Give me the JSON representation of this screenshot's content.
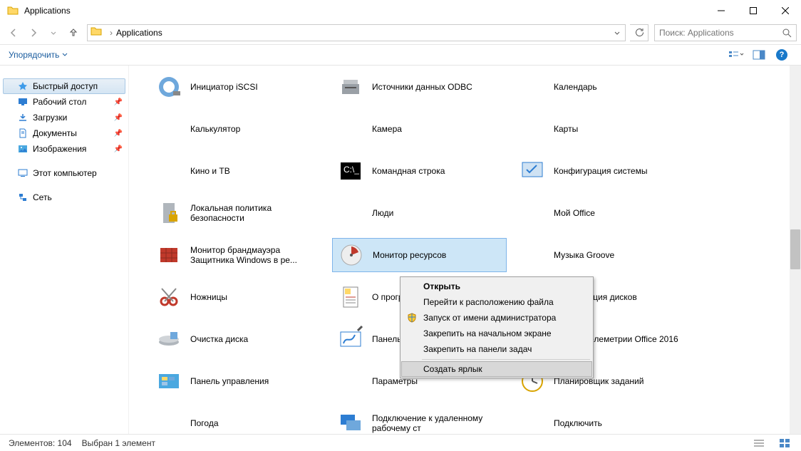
{
  "window": {
    "title": "Applications"
  },
  "address": {
    "breadcrumb": "Applications"
  },
  "search": {
    "placeholder": "Поиск: Applications"
  },
  "toolbar": {
    "organize_label": "Упорядочить"
  },
  "sidebar": {
    "quick_access": "Быстрый доступ",
    "desktop": "Рабочий стол",
    "downloads": "Загрузки",
    "documents": "Документы",
    "images": "Изображения",
    "this_pc": "Этот компьютер",
    "network": "Сеть"
  },
  "items": {
    "c0": [
      "Инициатор iSCSI",
      "Калькулятор",
      "Кино и ТВ",
      "Локальная политика безопасности",
      "Монитор брандмауэра Защитника Windows в ре...",
      "Ножницы",
      "Очистка диска",
      "Панель управления",
      "Погода"
    ],
    "c1": [
      "Источники данных ODBC",
      "Камера",
      "Командная строка",
      "Люди",
      "Монитор ресурсов",
      "О программе",
      "Панель математического ввода",
      "Параметры",
      "Подключение к удаленному рабочему ст"
    ],
    "c2": [
      "Календарь",
      "Карты",
      "Конфигурация системы",
      "Мой Office",
      "Музыка Groove",
      "Оптимизация дисков",
      "Панель телеметрии Office 2016",
      "Планировщик заданий",
      "Подключить"
    ]
  },
  "context_menu": {
    "open": "Открыть",
    "goto": "Перейти к расположению файла",
    "runas": "Запуск от имени администратора",
    "pin_start": "Закрепить на начальном экране",
    "pin_taskbar": "Закрепить на панели задач",
    "create_shortcut": "Создать ярлык"
  },
  "statusbar": {
    "count": "Элементов: 104",
    "selection": "Выбран 1 элемент"
  }
}
